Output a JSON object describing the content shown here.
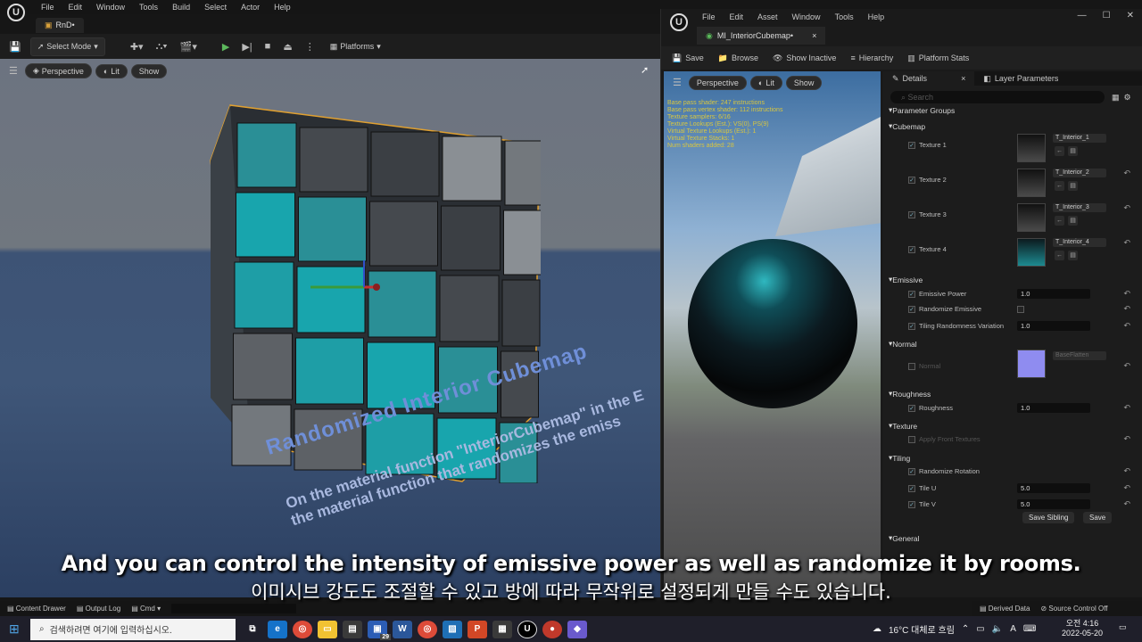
{
  "editor": {
    "menus": [
      "File",
      "Edit",
      "Window",
      "Tools",
      "Build",
      "Select",
      "Actor",
      "Help"
    ],
    "tab": "RnD•",
    "toolbar": {
      "select_mode": "Select Mode",
      "platforms": "Platforms"
    },
    "viewport": {
      "perspective": "Perspective",
      "lit": "Lit",
      "show": "Show"
    },
    "floor_title": "Randomized Interior Cubemap",
    "floor_line1": "On the material function \"InteriorCubemap\" in the E",
    "floor_line2": "the material function that randomizes the emiss"
  },
  "material_editor": {
    "menus": [
      "File",
      "Edit",
      "Asset",
      "Window",
      "Tools",
      "Help"
    ],
    "tab": "MI_InteriorCubemap•",
    "toolbar": [
      "Save",
      "Browse",
      "Show Inactive",
      "Hierarchy",
      "Platform Stats"
    ],
    "viewport": {
      "perspective": "Perspective",
      "lit": "Lit",
      "show": "Show"
    },
    "stats": [
      "Base pass shader: 247 instructions",
      "Base pass vertex shader: 112 instructions",
      "Texture samplers: 6/16",
      "Texture Lookups (Est.): VS(0), PS(9)",
      "Virtual Texture Lookups (Est.): 1",
      "Virtual Texture Stacks: 1",
      "Num shaders added: 28"
    ],
    "details": {
      "tab": "Details",
      "layer_tab": "Layer Parameters",
      "search": "Search",
      "groups": {
        "parameter_groups": "Parameter Groups",
        "cubemap": "Cubemap",
        "emissive": "Emissive",
        "normal": "Normal",
        "roughness": "Roughness",
        "texture": "Texture",
        "tiling": "Tiling",
        "general": "General"
      },
      "textures": [
        {
          "label": "Texture 1",
          "asset": "T_Interior_1"
        },
        {
          "label": "Texture 2",
          "asset": "T_Interior_2"
        },
        {
          "label": "Texture 3",
          "asset": "T_Interior_3"
        },
        {
          "label": "Texture 4",
          "asset": "T_Interior_4"
        }
      ],
      "emissive_power": {
        "label": "Emissive Power",
        "value": "1.0"
      },
      "randomize_emissive": {
        "label": "Randomize Emissive"
      },
      "tiling_rand": {
        "label": "Tiling Randomness Variation",
        "value": "1.0"
      },
      "normal": {
        "label": "Normal",
        "asset": "BaseFlatten"
      },
      "roughness": {
        "label": "Roughness",
        "value": "1.0"
      },
      "apply_front": {
        "label": "Apply Front Textures"
      },
      "randomize_rotation": {
        "label": "Randomize Rotation"
      },
      "tile_u": {
        "label": "Tile U",
        "value": "5.0"
      },
      "tile_v": {
        "label": "Tile V",
        "value": "5.0"
      },
      "save_sibling": "Save Sibling",
      "save": "Save"
    }
  },
  "bottom": {
    "content_drawer": "Content Drawer",
    "output_log": "Output Log",
    "cmd": "Cmd",
    "derived": "Derived Data",
    "source_control": "Source Control Off"
  },
  "subtitles": {
    "en": "And you can control the intensity of emissive power as well as randomize it by rooms.",
    "ko": "이미시브 강도도 조절할 수 있고 방에 따라 무작위로 설정되게 만들 수도 있습니다."
  },
  "taskbar": {
    "search": "검색하려면 여기에 입력하십시오.",
    "weather": "16°C 대체로 흐림",
    "time": "오전 4:16",
    "date": "2022-05-20",
    "badge": "29"
  }
}
